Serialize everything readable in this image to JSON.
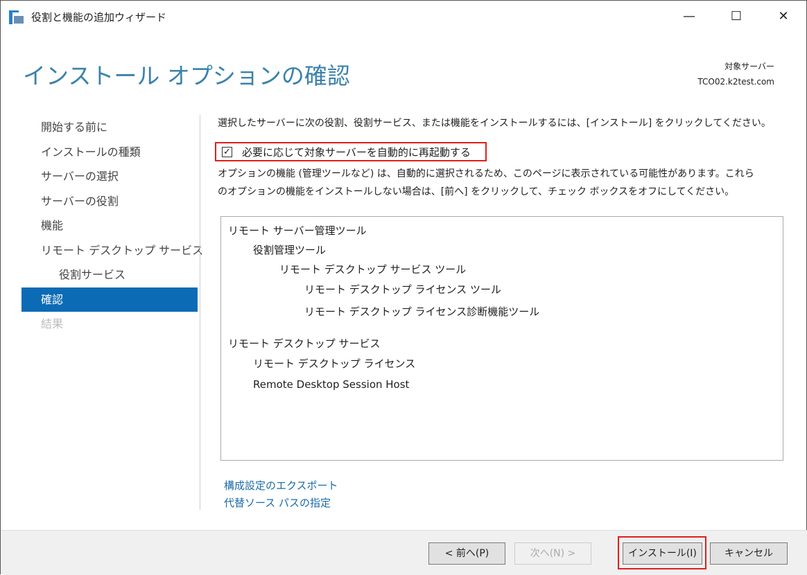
{
  "window": {
    "title": "役割と機能の追加ウィザード",
    "minimize": "—",
    "maximize": "☐",
    "close": "✕"
  },
  "header": {
    "title": "インストール オプションの確認",
    "target_label": "対象サーバー",
    "target_server": "TCO02.k2test.com"
  },
  "nav": [
    {
      "label": "開始する前に"
    },
    {
      "label": "インストールの種類"
    },
    {
      "label": "サーバーの選択"
    },
    {
      "label": "サーバーの役割"
    },
    {
      "label": "機能"
    },
    {
      "label": "リモート デスクトップ サービス"
    },
    {
      "label": "役割サービス"
    },
    {
      "label": "確認"
    },
    {
      "label": "結果"
    }
  ],
  "content": {
    "instruction": "選択したサーバーに次の役割、役割サービス、または機能をインストールするには、[インストール] をクリックしてください。",
    "restart_checkbox": {
      "label": "必要に応じて対象サーバーを自動的に再起動する",
      "checked": true,
      "mark": "✓"
    },
    "note_line1": "オプションの機能 (管理ツールなど) は、自動的に選択されるため、このページに表示されている可能性があります。これら",
    "note_line2": "のオプションの機能をインストールしない場合は、[前へ] をクリックして、チェック ボックスをオフにしてください。",
    "items": [
      "リモート サーバー管理ツール",
      "役割管理ツール",
      "リモート デスクトップ サービス ツール",
      "リモート デスクトップ ライセンス ツール",
      "リモート デスクトップ ライセンス診断機能ツール",
      "リモート デスクトップ サービス",
      "リモート デスクトップ ライセンス",
      "Remote Desktop Session Host"
    ],
    "links": [
      "構成設定のエクスポート",
      "代替ソース パスの指定"
    ]
  },
  "footer": {
    "prev": "< 前へ(P)",
    "next": "次へ(N) >",
    "install": "インストール(I)",
    "cancel": "キャンセル"
  }
}
